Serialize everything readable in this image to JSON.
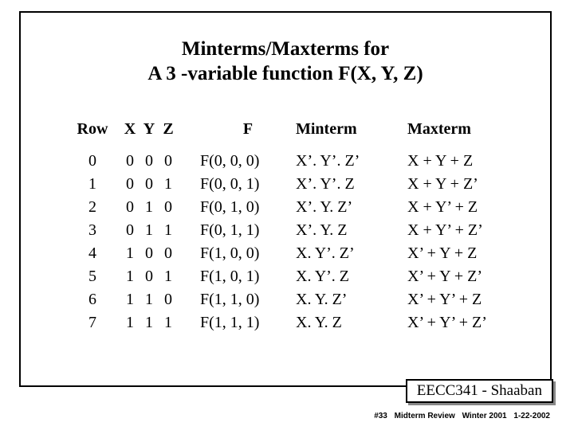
{
  "title_line1": "Minterms/Maxterms for",
  "title_line2": "A  3 -variable function  F(X, Y, Z)",
  "headers": {
    "row": "Row",
    "x": "X",
    "y": "Y",
    "z": "Z",
    "f": "F",
    "minterm": "Minterm",
    "maxterm": "Maxterm"
  },
  "rows": [
    {
      "row": "0",
      "x": "0",
      "y": "0",
      "z": "0",
      "f": "F(0, 0, 0)",
      "minterm": "X’. Y’. Z’",
      "maxterm": "X + Y + Z"
    },
    {
      "row": "1",
      "x": "0",
      "y": "0",
      "z": "1",
      "f": "F(0, 0, 1)",
      "minterm": "X’. Y’. Z",
      "maxterm": "X + Y + Z’"
    },
    {
      "row": "2",
      "x": "0",
      "y": "1",
      "z": "0",
      "f": "F(0, 1, 0)",
      "minterm": "X’. Y. Z’",
      "maxterm": "X + Y’ + Z"
    },
    {
      "row": "3",
      "x": "0",
      "y": "1",
      "z": "1",
      "f": "F(0, 1, 1)",
      "minterm": "X’. Y. Z",
      "maxterm": "X + Y’ + Z’"
    },
    {
      "row": "4",
      "x": "1",
      "y": "0",
      "z": "0",
      "f": "F(1, 0, 0)",
      "minterm": "X. Y’. Z’",
      "maxterm": "X’ + Y + Z"
    },
    {
      "row": "5",
      "x": "1",
      "y": "0",
      "z": "1",
      "f": "F(1, 0, 1)",
      "minterm": "X. Y’. Z",
      "maxterm": "X’ + Y + Z’"
    },
    {
      "row": "6",
      "x": "1",
      "y": "1",
      "z": "0",
      "f": "F(1, 1, 0)",
      "minterm": "X. Y. Z’",
      "maxterm": "X’ + Y’ + Z"
    },
    {
      "row": "7",
      "x": "1",
      "y": "1",
      "z": "1",
      "f": "F(1, 1, 1)",
      "minterm": "X. Y. Z",
      "maxterm": "X’ + Y’ + Z’"
    }
  ],
  "course_badge": "EECC341 - Shaaban",
  "footer": {
    "slide_no": "#33",
    "center": "Midterm Review",
    "term": "Winter 2001",
    "date": "1-22-2002"
  },
  "chart_data": {
    "type": "table",
    "title": "Minterms/Maxterms for A 3-variable function F(X,Y,Z)",
    "columns": [
      "Row",
      "X",
      "Y",
      "Z",
      "F",
      "Minterm",
      "Maxterm"
    ],
    "data": [
      [
        0,
        0,
        0,
        0,
        "F(0,0,0)",
        "X'.Y'.Z'",
        "X+Y+Z"
      ],
      [
        1,
        0,
        0,
        1,
        "F(0,0,1)",
        "X'.Y'.Z",
        "X+Y+Z'"
      ],
      [
        2,
        0,
        1,
        0,
        "F(0,1,0)",
        "X'.Y.Z'",
        "X+Y'+Z"
      ],
      [
        3,
        0,
        1,
        1,
        "F(0,1,1)",
        "X'.Y.Z",
        "X+Y'+Z'"
      ],
      [
        4,
        1,
        0,
        0,
        "F(1,0,0)",
        "X.Y'.Z'",
        "X'+Y+Z"
      ],
      [
        5,
        1,
        0,
        1,
        "F(1,0,1)",
        "X.Y'.Z",
        "X'+Y+Z'"
      ],
      [
        6,
        1,
        1,
        0,
        "F(1,1,0)",
        "X.Y.Z'",
        "X'+Y'+Z"
      ],
      [
        7,
        1,
        1,
        1,
        "F(1,1,1)",
        "X.Y.Z",
        "X'+Y'+Z'"
      ]
    ]
  }
}
